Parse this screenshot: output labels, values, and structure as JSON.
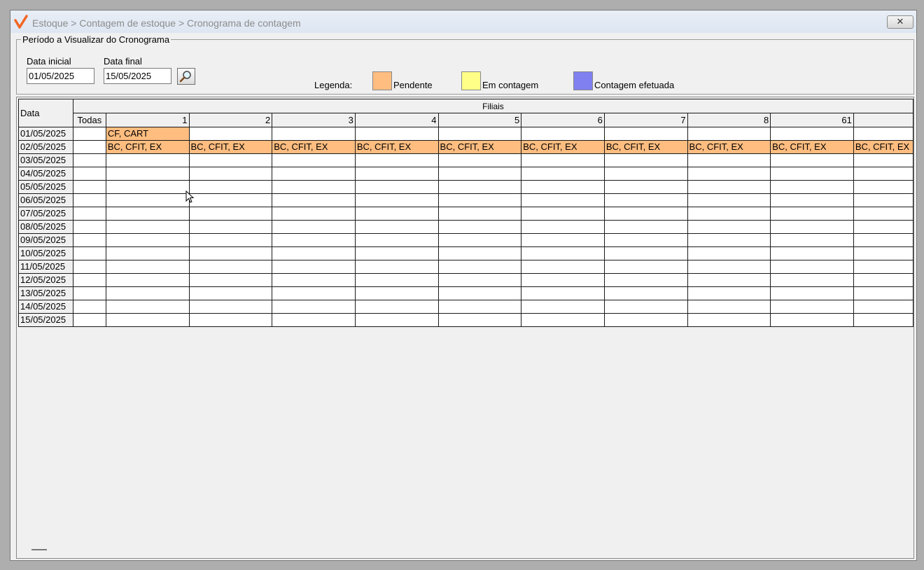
{
  "window": {
    "breadcrumb": "Estoque > Contagem de estoque > Cronograma de contagem",
    "close_label": "✕"
  },
  "period": {
    "legend": "Período a Visualizar do Cronograma",
    "start_label": "Data inicial",
    "start_value": "01/05/2025",
    "end_label": "Data final",
    "end_value": "15/05/2025",
    "search_icon": "magnifier-icon"
  },
  "legend": {
    "label": "Legenda:",
    "items": [
      {
        "label": "Pendente",
        "color": "#ffbd80"
      },
      {
        "label": "Em contagem",
        "color": "#ffff88"
      },
      {
        "label": "Contagem efetuada",
        "color": "#8080f0"
      }
    ]
  },
  "grid": {
    "date_header": "Data",
    "group_header": "Filiais",
    "all_header": "Todas",
    "branches": [
      "1",
      "2",
      "3",
      "4",
      "5",
      "6",
      "7",
      "8",
      "61",
      ""
    ],
    "rows": [
      {
        "date": "01/05/2025",
        "todas": "",
        "cells": [
          "CF, CART",
          "",
          "",
          "",
          "",
          "",
          "",
          "",
          "",
          ""
        ]
      },
      {
        "date": "02/05/2025",
        "todas": "",
        "cells": [
          "BC, CFIT, EX",
          "BC, CFIT, EX",
          "BC, CFIT, EX",
          "BC, CFIT, EX",
          "BC, CFIT, EX",
          "BC, CFIT, EX",
          "BC, CFIT, EX",
          "BC, CFIT, EX",
          "BC, CFIT, EX",
          "BC, CFIT, EX"
        ]
      },
      {
        "date": "03/05/2025",
        "todas": "",
        "cells": [
          "",
          "",
          "",
          "",
          "",
          "",
          "",
          "",
          "",
          ""
        ]
      },
      {
        "date": "04/05/2025",
        "todas": "",
        "cells": [
          "",
          "",
          "",
          "",
          "",
          "",
          "",
          "",
          "",
          ""
        ]
      },
      {
        "date": "05/05/2025",
        "todas": "",
        "cells": [
          "",
          "",
          "",
          "",
          "",
          "",
          "",
          "",
          "",
          ""
        ]
      },
      {
        "date": "06/05/2025",
        "todas": "",
        "cells": [
          "",
          "",
          "",
          "",
          "",
          "",
          "",
          "",
          "",
          ""
        ]
      },
      {
        "date": "07/05/2025",
        "todas": "",
        "cells": [
          "",
          "",
          "",
          "",
          "",
          "",
          "",
          "",
          "",
          ""
        ]
      },
      {
        "date": "08/05/2025",
        "todas": "",
        "cells": [
          "",
          "",
          "",
          "",
          "",
          "",
          "",
          "",
          "",
          ""
        ]
      },
      {
        "date": "09/05/2025",
        "todas": "",
        "cells": [
          "",
          "",
          "",
          "",
          "",
          "",
          "",
          "",
          "",
          ""
        ]
      },
      {
        "date": "10/05/2025",
        "todas": "",
        "cells": [
          "",
          "",
          "",
          "",
          "",
          "",
          "",
          "",
          "",
          ""
        ]
      },
      {
        "date": "11/05/2025",
        "todas": "",
        "cells": [
          "",
          "",
          "",
          "",
          "",
          "",
          "",
          "",
          "",
          ""
        ]
      },
      {
        "date": "12/05/2025",
        "todas": "",
        "cells": [
          "",
          "",
          "",
          "",
          "",
          "",
          "",
          "",
          "",
          ""
        ]
      },
      {
        "date": "13/05/2025",
        "todas": "",
        "cells": [
          "",
          "",
          "",
          "",
          "",
          "",
          "",
          "",
          "",
          ""
        ]
      },
      {
        "date": "14/05/2025",
        "todas": "",
        "cells": [
          "",
          "",
          "",
          "",
          "",
          "",
          "",
          "",
          "",
          ""
        ]
      },
      {
        "date": "15/05/2025",
        "todas": "",
        "cells": [
          "",
          "",
          "",
          "",
          "",
          "",
          "",
          "",
          "",
          ""
        ]
      }
    ],
    "pending_color": "#ffbd80"
  }
}
